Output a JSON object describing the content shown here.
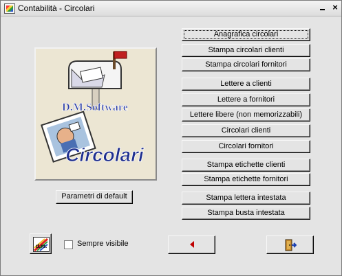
{
  "window": {
    "title": "Contabilità - Circolari",
    "close_glyph": "×"
  },
  "logo": {
    "brand": "D.M.Software",
    "product": "Circolari",
    "icon": "mailbox-illustration"
  },
  "buttons": [
    {
      "label": "Anagrafica circolari"
    },
    {
      "label": "Stampa circolari clienti"
    },
    {
      "label": "Stampa circolari fornitori"
    },
    {
      "label": "Lettere a clienti"
    },
    {
      "label": "Lettere a fornitori"
    },
    {
      "label": "Lettere libere (non memorizzabili)"
    },
    {
      "label": "Circolari clienti"
    },
    {
      "label": "Circolari fornitori"
    },
    {
      "label": "Stampa etichette clienti"
    },
    {
      "label": "Stampa etichette fornitori"
    },
    {
      "label": "Stampa lettera intestata"
    },
    {
      "label": "Stampa busta intestata"
    }
  ],
  "defaults_button": {
    "label": "Parametri di default"
  },
  "always_visible": {
    "label": "Sempre visibile",
    "checked": false
  },
  "dm_button": {
    "text": "d.m.",
    "icon": "dm-logo-icon"
  },
  "back_button": {
    "icon": "arrow-left-icon"
  },
  "exit_button": {
    "icon": "exit-door-icon"
  },
  "colors": {
    "back_arrow": "#c00000",
    "exit_arrow": "#1a3fb0",
    "brand_text": "#2c3fa8"
  }
}
